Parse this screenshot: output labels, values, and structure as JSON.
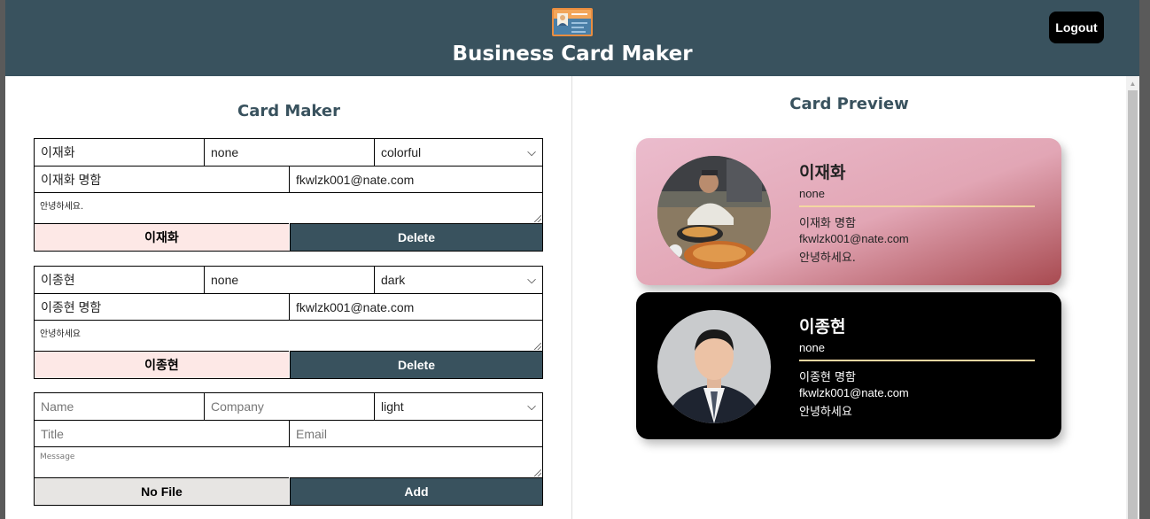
{
  "header": {
    "title": "Business Card Maker",
    "logout_label": "Logout",
    "logo_icon": "business-card-icon"
  },
  "maker": {
    "title": "Card Maker",
    "cards": [
      {
        "name": "이재화",
        "company": "none",
        "theme": "colorful",
        "title": "이재화 명함",
        "email": "fkwlzk001@nate.com",
        "message": "안녕하세요.",
        "file_label": "이재화",
        "action_label": "Delete"
      },
      {
        "name": "이종현",
        "company": "none",
        "theme": "dark",
        "title": "이종현 명함",
        "email": "fkwlzk001@nate.com",
        "message": "안녕하세요",
        "file_label": "이종현",
        "action_label": "Delete"
      }
    ],
    "add_form": {
      "name_placeholder": "Name",
      "company_placeholder": "Company",
      "theme": "light",
      "title_placeholder": "Title",
      "email_placeholder": "Email",
      "message_placeholder": "Message",
      "file_label": "No File",
      "action_label": "Add"
    }
  },
  "preview": {
    "title": "Card Preview",
    "cards": [
      {
        "name": "이재화",
        "company": "none",
        "title": "이재화 명함",
        "email": "fkwlzk001@nate.com",
        "message": "안녕하세요.",
        "theme": "colorful"
      },
      {
        "name": "이종현",
        "company": "none",
        "title": "이종현 명함",
        "email": "fkwlzk001@nate.com",
        "message": "안녕하세요",
        "theme": "dark"
      }
    ]
  },
  "colors": {
    "header_bg": "#39525e",
    "button_bg": "#39525e",
    "file_button_pink": "#fde8e6",
    "card_divider": "#f3d7a1"
  }
}
